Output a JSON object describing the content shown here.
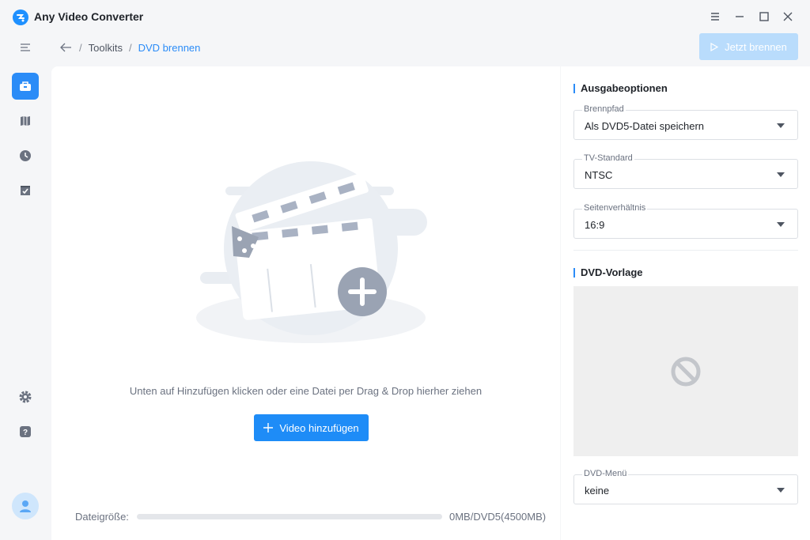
{
  "app": {
    "title": "Any Video Converter"
  },
  "window_controls": {
    "menu_icon": "menu-icon",
    "minimize_icon": "minimize-icon",
    "maximize_icon": "maximize-icon",
    "close_icon": "close-icon"
  },
  "rail": {
    "items": [
      {
        "name": "toolbox-icon",
        "active": true
      },
      {
        "name": "map-icon",
        "active": false
      },
      {
        "name": "clock-icon",
        "active": false
      },
      {
        "name": "task-check-icon",
        "active": false
      },
      {
        "name": "gear-icon",
        "active": false
      },
      {
        "name": "help-icon",
        "active": false
      },
      {
        "name": "avatar-icon",
        "active": false
      }
    ]
  },
  "breadcrumb": {
    "root": "Toolkits",
    "separator": "/",
    "current": "DVD brennen"
  },
  "toolbar": {
    "burn_label": "Jetzt brennen"
  },
  "main": {
    "hint": "Unten auf Hinzufügen klicken oder eine Datei per Drag & Drop hierher ziehen",
    "add_label": "Video hinzufügen",
    "file_size_label": "Dateigröße:",
    "file_size_value": "0MB/DVD5(4500MB)",
    "file_size_fraction": 0
  },
  "panel": {
    "output_title": "Ausgabeoptionen",
    "burn_path": {
      "label": "Brennpfad",
      "value": "Als DVD5-Datei speichern"
    },
    "tv_standard": {
      "label": "TV-Standard",
      "value": "NTSC"
    },
    "aspect_ratio": {
      "label": "Seitenverhältnis",
      "value": "16:9"
    },
    "template_title": "DVD-Vorlage",
    "dvd_menu": {
      "label": "DVD-Menü",
      "value": "keine"
    }
  },
  "colors": {
    "accent": "#2b8cf7",
    "disabled_button": "#b9dcfc",
    "background": "#f5f6f8"
  }
}
